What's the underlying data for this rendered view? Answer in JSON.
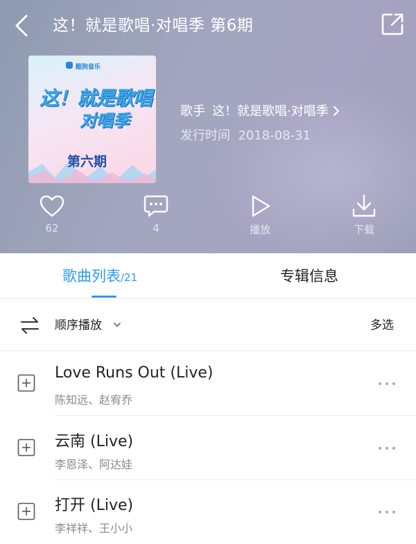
{
  "header": {
    "title": "这！就是歌唱·对唱季 第6期",
    "back_icon": "chevron-left-icon",
    "share_icon": "share-icon"
  },
  "album": {
    "cover": {
      "brand": "酷狗音乐",
      "logo_line1": "这！就是歌唱",
      "logo_line2": "对唱季",
      "episode": "第六期"
    },
    "artist_label": "歌手",
    "artist_name": "这！就是歌唱·对唱季",
    "release_label": "发行时间",
    "release_date": "2018-08-31"
  },
  "actions": [
    {
      "icon": "heart-icon",
      "label": "62"
    },
    {
      "icon": "comment-icon",
      "label": "4"
    },
    {
      "icon": "play-icon",
      "label": "播放"
    },
    {
      "icon": "download-icon",
      "label": "下载"
    }
  ],
  "tabs": {
    "songs_label": "歌曲列表",
    "songs_count": "/21",
    "info_label": "专辑信息",
    "active": "songs"
  },
  "toolbar": {
    "order_label": "顺序播放",
    "multi_select_label": "多选"
  },
  "songs": [
    {
      "title": "Love Runs Out (Live)",
      "artists": "陈知远、赵宥乔"
    },
    {
      "title": "云南 (Live)",
      "artists": "李恩泽、阿达娃"
    },
    {
      "title": "打开 (Live)",
      "artists": "李祥祥、王小小"
    }
  ],
  "colors": {
    "accent": "#2e9bf0",
    "header_bg": "#a1a4bd",
    "text_primary": "#222222",
    "text_secondary": "#8a8a8a"
  }
}
